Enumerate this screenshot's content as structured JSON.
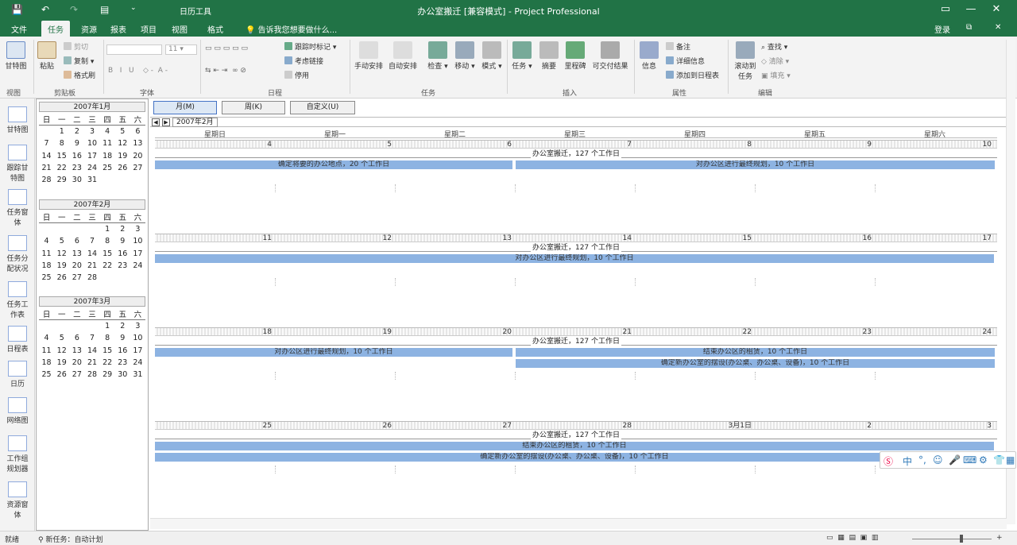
{
  "titlebar": {
    "title": "办公室搬迁 [兼容模式] - Project Professional",
    "context_tools": "日历工具",
    "login": "登录"
  },
  "tabs": [
    "文件",
    "任务",
    "资源",
    "报表",
    "项目",
    "视图",
    "格式"
  ],
  "tell_me": "告诉我您想要做什么...",
  "ribbon": {
    "view_btn": "甘特图",
    "paste": "粘贴",
    "cut": "剪切",
    "copy": "复制",
    "format_painter": "格式刷",
    "mark_on_track": "跟踪时标记",
    "respect_links": "考虑链接",
    "inactivate": "停用",
    "manual_schedule": "手动安排",
    "auto_schedule": "自动安排",
    "inspect": "检查",
    "move": "移动",
    "mode": "模式",
    "task": "任务",
    "summary": "摘要",
    "milestone": "里程碑",
    "deliverable": "可交付结果",
    "information": "信息",
    "notes": "备注",
    "details": "详细信息",
    "add_to_timeline": "添加到日程表",
    "scroll_to_task": "滚动到\n任务",
    "find": "查找",
    "clear": "清除",
    "fill": "填充",
    "groups": {
      "view": "视图",
      "clipboard": "剪贴板",
      "font": "字体",
      "schedule": "日程",
      "tasks": "任务",
      "insert": "插入",
      "properties": "属性",
      "editing": "编辑"
    }
  },
  "view_bar": [
    "甘特图",
    "跟踪甘特图",
    "任务分配状况",
    "任务分配状况",
    "任务工作表",
    "日程表",
    "日历",
    "网络图",
    "工作组规划器",
    "资源使用状况"
  ],
  "view_bar_labels": [
    [
      "甘特图"
    ],
    [
      "跟踪甘",
      "特图"
    ],
    [
      "任务窗",
      "体"
    ],
    [
      "任务分",
      "配状况"
    ],
    [
      "任务工",
      "作表"
    ],
    [
      "日程表"
    ],
    [
      "日历"
    ],
    [
      "网络图"
    ],
    [
      "工作组",
      "规划器"
    ],
    [
      "资源窗",
      "体"
    ]
  ],
  "minicals": [
    {
      "title": "2007年1月",
      "weekdays": [
        "日",
        "一",
        "二",
        "三",
        "四",
        "五",
        "六"
      ],
      "days": [
        "",
        "1",
        "2",
        "3",
        "4",
        "5",
        "6",
        "7",
        "8",
        "9",
        "10",
        "11",
        "12",
        "13",
        "14",
        "15",
        "16",
        "17",
        "18",
        "19",
        "20",
        "21",
        "22",
        "23",
        "24",
        "25",
        "26",
        "27",
        "28",
        "29",
        "30",
        "31",
        "",
        "",
        ""
      ]
    },
    {
      "title": "2007年2月",
      "weekdays": [
        "日",
        "一",
        "二",
        "三",
        "四",
        "五",
        "六"
      ],
      "days": [
        "",
        "",
        "",
        "",
        "1",
        "2",
        "3",
        "4",
        "5",
        "6",
        "7",
        "8",
        "9",
        "10",
        "11",
        "12",
        "13",
        "14",
        "15",
        "16",
        "17",
        "18",
        "19",
        "20",
        "21",
        "22",
        "23",
        "24",
        "25",
        "26",
        "27",
        "28",
        "",
        "",
        ""
      ]
    },
    {
      "title": "2007年3月",
      "weekdays": [
        "日",
        "一",
        "二",
        "三",
        "四",
        "五",
        "六"
      ],
      "days": [
        "",
        "",
        "",
        "",
        "1",
        "2",
        "3",
        "4",
        "5",
        "6",
        "7",
        "8",
        "9",
        "10",
        "11",
        "12",
        "13",
        "14",
        "15",
        "16",
        "17",
        "18",
        "19",
        "20",
        "21",
        "22",
        "23",
        "24",
        "25",
        "26",
        "27",
        "28",
        "29",
        "30",
        "31"
      ]
    }
  ],
  "calendar": {
    "view_buttons": [
      "月(M)",
      "周(K)",
      "自定义(U)"
    ],
    "month_label": "2007年2月",
    "weekdays": [
      "星期日",
      "星期一",
      "星期二",
      "星期三",
      "星期四",
      "星期五",
      "星期六"
    ],
    "summary": "办公室搬迁，127 个工作日",
    "weeks": [
      {
        "dates": [
          "4",
          "5",
          "6",
          "7",
          "8",
          "9",
          "10"
        ],
        "bars": [
          {
            "label": "确定将要的办公地点，20 个工作日",
            "start": 0,
            "end": 3,
            "row": 0
          },
          {
            "label": "对办公区进行最终规划，10 个工作日",
            "start": 3,
            "end": 7,
            "row": 0
          }
        ]
      },
      {
        "dates": [
          "11",
          "12",
          "13",
          "14",
          "15",
          "16",
          "17"
        ],
        "bars": [
          {
            "label": "对办公区进行最终规划，10 个工作日",
            "start": 0,
            "end": 7,
            "row": 0
          }
        ]
      },
      {
        "dates": [
          "18",
          "19",
          "20",
          "21",
          "22",
          "23",
          "24"
        ],
        "bars": [
          {
            "label": "对办公区进行最终规划，10 个工作日",
            "start": 0,
            "end": 3,
            "row": 0
          },
          {
            "label": "结束办公区的租赁，10 个工作日",
            "start": 3,
            "end": 7,
            "row": 0
          },
          {
            "label": "确定新办公室的摆设(办公桌、办公桌、设备)，10 个工作日",
            "start": 3,
            "end": 7,
            "row": 1
          }
        ]
      },
      {
        "dates": [
          "25",
          "26",
          "27",
          "28",
          "3月1日",
          "2",
          "3"
        ],
        "bars": [
          {
            "label": "结束办公区的租赁，10 个工作日",
            "start": 0,
            "end": 7,
            "row": 0
          },
          {
            "label": "确定新办公室的摆设(办公桌、办公桌、设备)，10 个工作日",
            "start": 0,
            "end": 7,
            "row": 1
          }
        ]
      }
    ]
  },
  "status": {
    "ready": "就绪",
    "new_tasks": "新任务：自动计划"
  },
  "colors": {
    "accent": "#217346",
    "bar": "#8db3e2"
  }
}
